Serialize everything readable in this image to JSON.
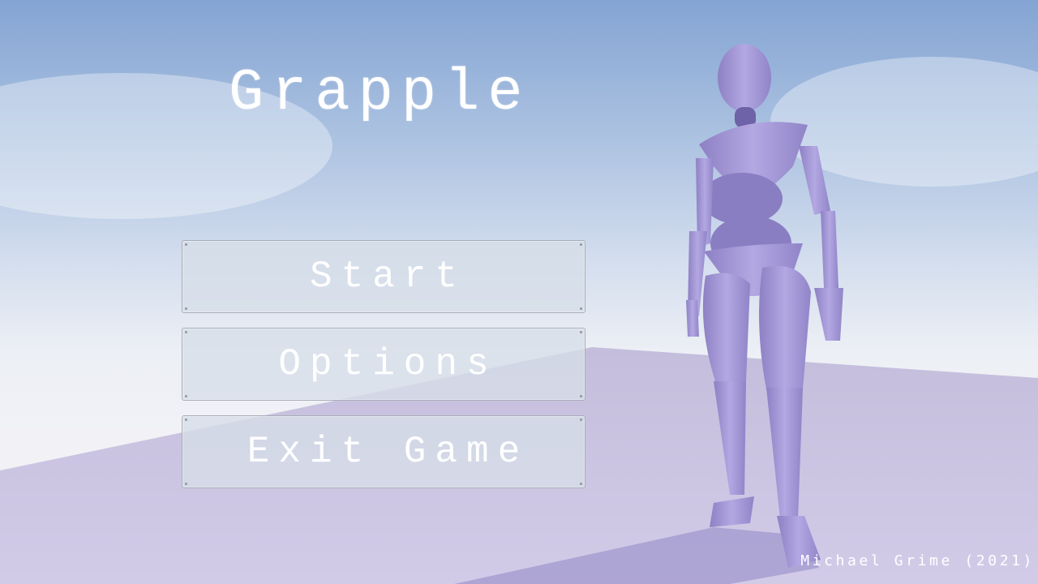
{
  "title": "Grapple",
  "menu": {
    "items": [
      {
        "label": "Start"
      },
      {
        "label": "Options"
      },
      {
        "label": "Exit Game"
      }
    ]
  },
  "credit": "Michael Grime (2021)",
  "colors": {
    "ground": "#cbc4e2",
    "mannequin": "#a89cd8",
    "button_fill": "#d6dee8"
  }
}
